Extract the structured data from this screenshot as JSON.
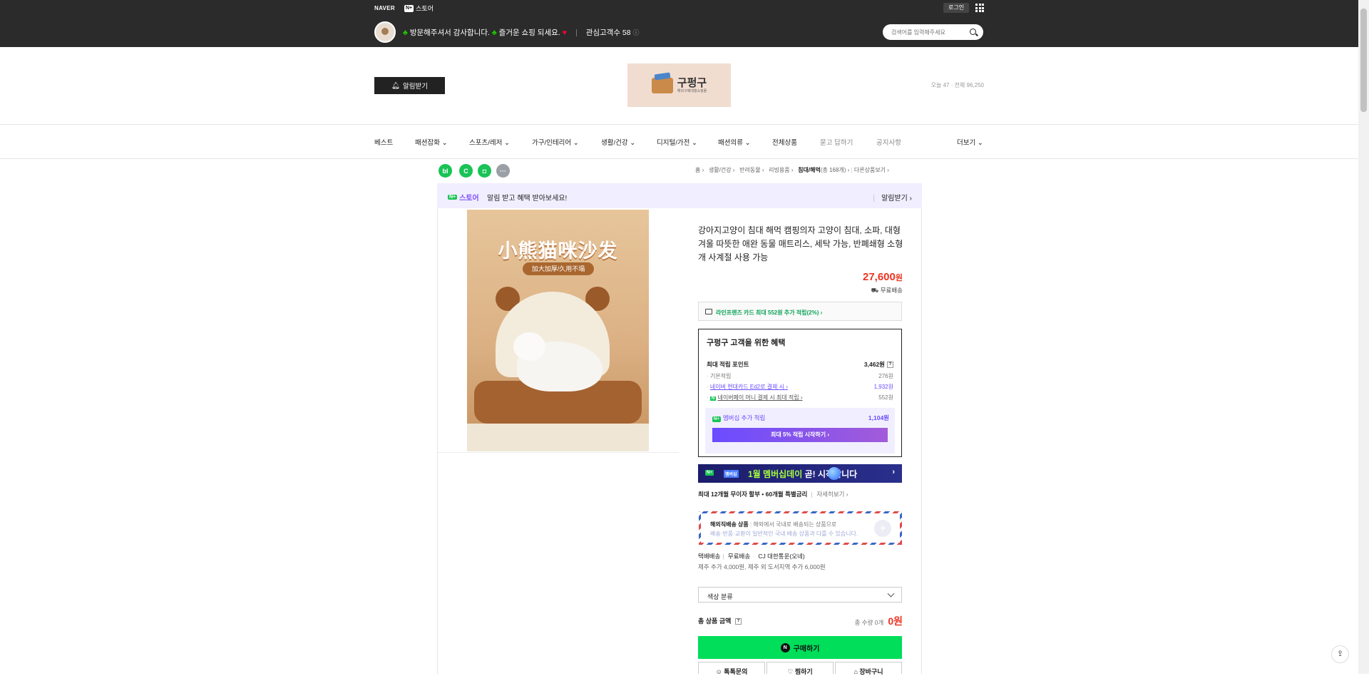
{
  "gnb": {
    "naver": "NAVER",
    "store_badge": "N+",
    "store": "스토어",
    "login": "로그인",
    "welcome_1": "방문해주셔서 감사합니다.",
    "welcome_2": "즐거운 쇼핑 되세요.",
    "interest": "관심고객수 58",
    "search_placeholder": "검색어를 입력해주세요"
  },
  "header": {
    "alarm": "알림받기",
    "logo_text": "구펑구",
    "logo_sub": "해외구매대행쇼핑몰",
    "visit": "오늘 47 · 전체 96,250"
  },
  "menu": [
    "베스트",
    "패션잡화 ⌄",
    "스포츠/레저 ⌄",
    "가구/인테리어 ⌄",
    "생활/건강 ⌄",
    "디지털/가전 ⌄",
    "패션의류 ⌄",
    "전체상품",
    "묻고 답하기",
    "공지사항",
    "더보기 ⌄"
  ],
  "breadcrumb": {
    "items": [
      "홈 ›",
      "생활/건강 ›",
      "반려동물 ›",
      "리빙용품 ›"
    ],
    "current": "침대/해먹",
    "count": "(총 168개)",
    "other": "다른상품보기 ›"
  },
  "sns": [
    "bl",
    "C",
    "◘",
    "···"
  ],
  "promo": {
    "badge": "N+",
    "store": "스토어",
    "text": "알림 받고 혜택 받아보세요!",
    "cta": "알림받기 ›"
  },
  "product": {
    "image_title": "小熊猫咪沙发",
    "image_sub": "加大加厚/久用不塌",
    "title": "강아지고양이 침대 해먹 캠핑의자 고양이 침대, 소파, 대형 겨울 따뜻한 애완 동물 매트리스, 세탁 가능, 반폐쇄형 소형 개 사계절 사용 가능",
    "price": "27,600",
    "price_unit": "원",
    "shipping": "무료배송",
    "card_promo": "라인프렌즈 카드 최대 552원 추가 적립(2%) ›"
  },
  "benefit": {
    "title": "구펑구 고객을 위한 혜택",
    "max_label": "최대 적립 포인트",
    "max_value": "3,462원",
    "rows": [
      {
        "label": "기본적립",
        "value": "276원"
      },
      {
        "label": "네이버 현대카드 Ed2로 결제 시 ›",
        "value": "1,932원"
      },
      {
        "label": "네이버페이 머니 결제 시 최대 적립 ›",
        "value": "552원"
      }
    ],
    "member_badge": "N+",
    "member_label": "멤버십 추가 적립",
    "member_value": "1,104원",
    "member_btn": "최대 5% 적립 시작하기 ›"
  },
  "event": {
    "badge1": "N+",
    "badge2": "멤버십",
    "text_a": "1월 멤버십데이",
    "text_b": " 곧! 시작합니다",
    "arrow": "›"
  },
  "installment": {
    "text": "최대 12개월 무이자 할부 • 60개월 특별금리",
    "more": "자세히보기 ›"
  },
  "overseas": {
    "title": "해외직배송 상품",
    "desc": "해외에서 국내로 배송되는 상품으로",
    "desc2": "배송·반품·교환이 일반적인 국내 배송 상품과 다를 수 있습니다.",
    "icon": "✈"
  },
  "delivery": {
    "label": "택배배송",
    "fee": "무료배송",
    "carrier": "CJ 대한통운(오네)",
    "extra": "제주 추가 4,000원, 제주 외 도서지역 추가 6,000원"
  },
  "option": {
    "placeholder": "색상 분류"
  },
  "total": {
    "label": "총 상품 금액",
    "qty": "총 수량 0개",
    "amount": "0원"
  },
  "buttons": {
    "buy": "구매하기",
    "buy_n": "N",
    "talk": "톡톡문의",
    "wish": "찜하기",
    "cart": "장바구니"
  },
  "colors": {
    "accent_green": "#00de5a",
    "price_red": "#ee3322",
    "purple": "#6a4cff"
  }
}
